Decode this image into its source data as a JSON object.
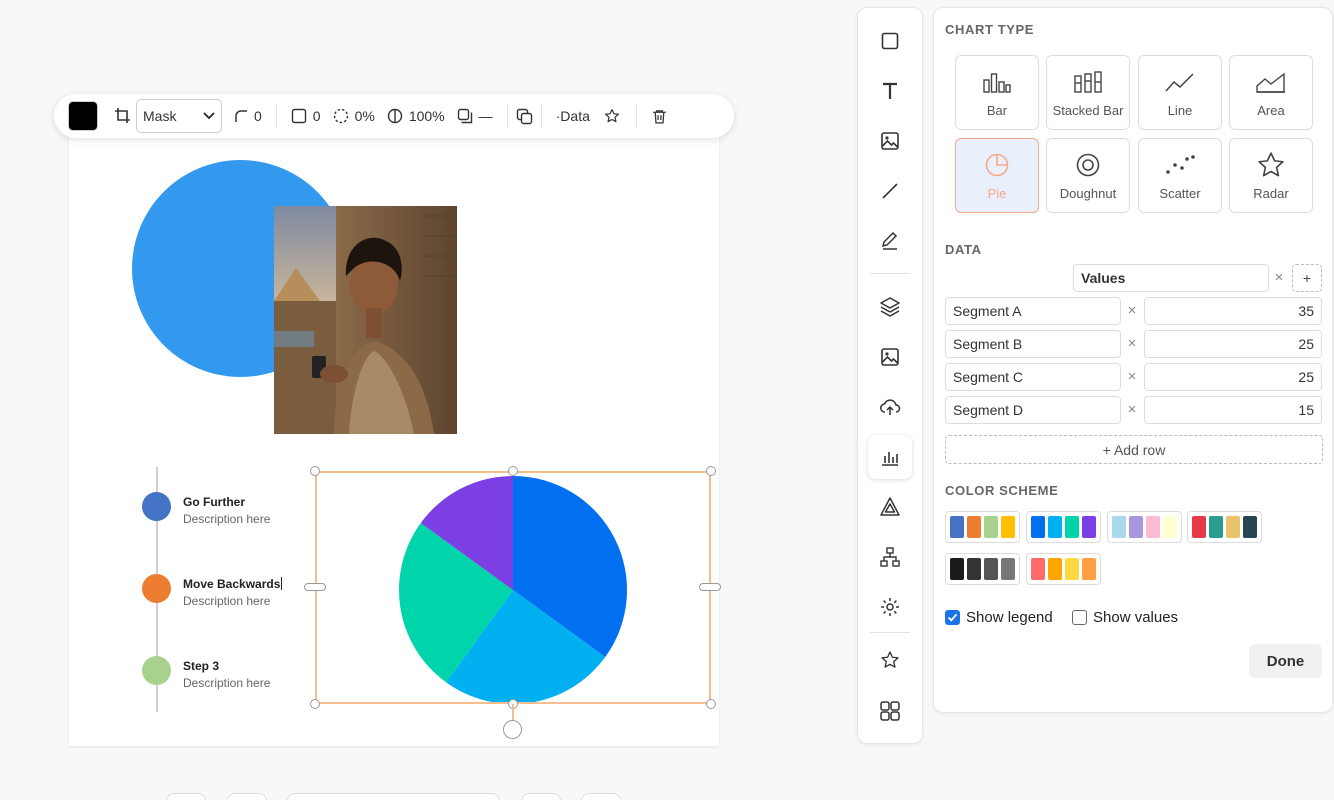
{
  "colors": {
    "blue_circle": "#3399ee",
    "selection": "#f6bd8f",
    "accent": "#1a73e8",
    "active_chart_type": "#f4a98a"
  },
  "toolbar": {
    "fill_color": "#000000",
    "mask_select": "Mask",
    "corner_radius": "0",
    "border_width": "0",
    "opacity_a": "0%",
    "opacity_b": "100%",
    "shadow": "—",
    "data_label": "·Data"
  },
  "timeline": {
    "steps": [
      {
        "title": "Go Further",
        "description": "Description here",
        "color": "#4472c4"
      },
      {
        "title": "Move Backwards",
        "description": "Description here",
        "color": "#ed7d31"
      },
      {
        "title": "Step 3",
        "description": "Description here",
        "color": "#a9d18e"
      }
    ]
  },
  "tools": [
    "square-icon",
    "text-icon",
    "image-icon",
    "line-icon",
    "pen-icon",
    "layers-icon",
    "image-icon",
    "upload-icon",
    "chart-icon",
    "triangle-icon",
    "diagram-icon",
    "settings-icon",
    "star-icon",
    "grid-icon"
  ],
  "panel": {
    "chart_type_heading": "CHART TYPE",
    "chart_types": [
      {
        "label": "Bar",
        "icon": "bar-chart-icon"
      },
      {
        "label": "Stacked Bar",
        "icon": "stacked-bar-icon"
      },
      {
        "label": "Line",
        "icon": "line-chart-icon"
      },
      {
        "label": "Area",
        "icon": "area-chart-icon"
      },
      {
        "label": "Pie",
        "icon": "pie-chart-icon",
        "selected": true
      },
      {
        "label": "Doughnut",
        "icon": "doughnut-icon"
      },
      {
        "label": "Scatter",
        "icon": "scatter-icon"
      },
      {
        "label": "Radar",
        "icon": "radar-icon"
      }
    ],
    "data_heading": "DATA",
    "series_name": "Values",
    "rows": [
      {
        "label": "Segment A",
        "value": "35"
      },
      {
        "label": "Segment B",
        "value": "25"
      },
      {
        "label": "Segment C",
        "value": "25"
      },
      {
        "label": "Segment D",
        "value": "15"
      }
    ],
    "add_row_label": "+ Add row",
    "plus_label": "+",
    "remove_glyph": "×",
    "color_scheme_heading": "COLOR SCHEME",
    "schemes": [
      [
        "#4472c4",
        "#ed7d31",
        "#a9d18e",
        "#ffc000"
      ],
      [
        "#0070f0",
        "#00b0f0",
        "#00d4aa",
        "#7b3fe4"
      ],
      [
        "#a8d8ea",
        "#aa96da",
        "#fcbad3",
        "#ffffd2"
      ],
      [
        "#e63946",
        "#2a9d8f",
        "#e9c46a",
        "#264653"
      ],
      [
        "#1a1a1a",
        "#333333",
        "#555555",
        "#777777"
      ],
      [
        "#ff6b6b",
        "#ffa500",
        "#ffd93d",
        "#ff9f43"
      ]
    ],
    "show_legend_label": "Show legend",
    "show_legend": true,
    "show_values_label": "Show values",
    "show_values": false,
    "done_label": "Done"
  },
  "chart_data": {
    "type": "pie",
    "categories": [
      "Segment A",
      "Segment B",
      "Segment C",
      "Segment D"
    ],
    "values": [
      35,
      25,
      25,
      15
    ],
    "colors": [
      "#0070f0",
      "#00b0f0",
      "#00d4aa",
      "#7b3fe4"
    ],
    "title": "",
    "legend": false
  }
}
